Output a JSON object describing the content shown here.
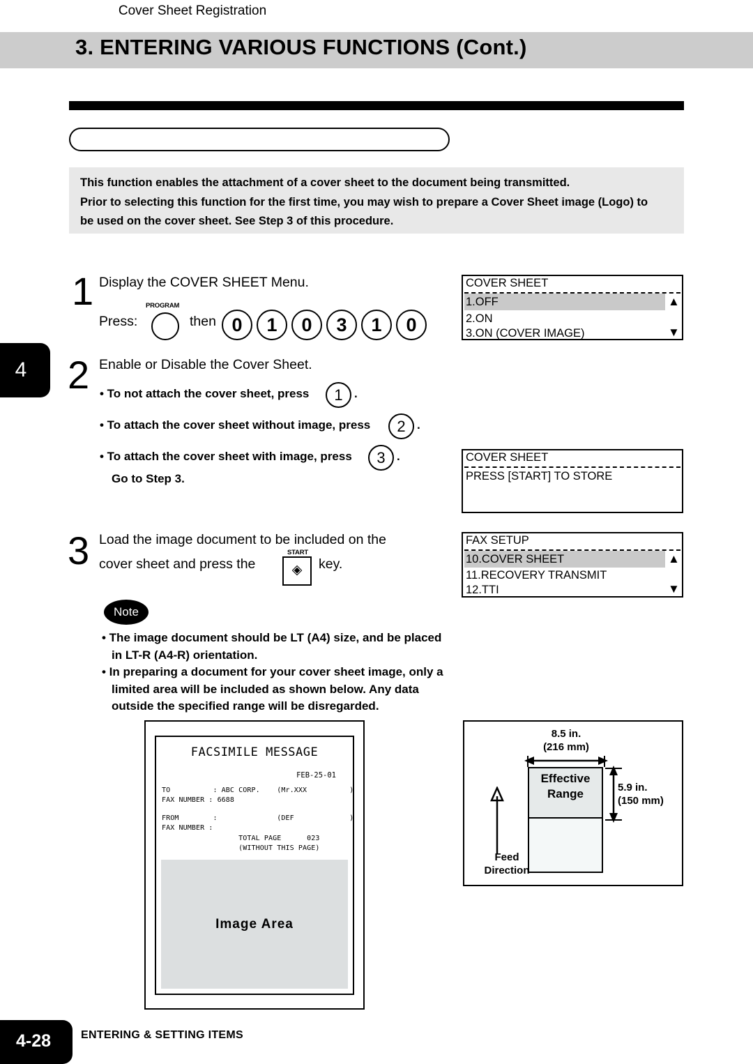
{
  "header": {
    "title": "3. ENTERING VARIOUS FUNCTIONS (Cont.)"
  },
  "section": {
    "pill_label": "Cover Sheet Registration"
  },
  "intro": {
    "line1": "This function enables the attachment of a cover sheet to the document being transmitted.",
    "line2": "Prior to selecting this function for the first time, you may wish to prepare a Cover Sheet image (Logo) to",
    "line3": "be used on the cover sheet.  See Step 3 of this procedure."
  },
  "chapter_tab": {
    "number": "4"
  },
  "steps": {
    "step1": {
      "number": "1",
      "instruction": "Display the COVER SHEET Menu.",
      "press_label": "Press:",
      "program_key_label": "PROGRAM",
      "then_label": "then",
      "keys": [
        "0",
        "1",
        "0",
        "3",
        "1",
        "0"
      ]
    },
    "step2": {
      "number": "2",
      "instruction": "Enable or Disable the Cover Sheet.",
      "bullets": [
        {
          "text": "• To not attach the cover sheet, press",
          "key": "1",
          "suffix": "."
        },
        {
          "text": "• To attach the cover sheet without image, press",
          "key": "2",
          "suffix": "."
        },
        {
          "text": "• To attach the cover sheet with image, press",
          "key": "3",
          "suffix": "."
        }
      ],
      "goto_line": "Go to Step 3."
    },
    "step3": {
      "number": "3",
      "line1": "Load  the  image  document  to be  included  on  the",
      "line2a": "cover sheet and press the",
      "line2b": "key.",
      "start_key_label": "START",
      "start_key_glyph": "◈"
    }
  },
  "lcd_panels": [
    {
      "title": "COVER SHEET",
      "rows": [
        {
          "text": "1.OFF",
          "selected": true,
          "arrow": "▲"
        },
        {
          "text": "2.ON",
          "selected": false,
          "arrow": ""
        },
        {
          "text": "3.ON (COVER IMAGE)",
          "selected": false,
          "arrow": "▼"
        }
      ]
    },
    {
      "title": "COVER SHEET",
      "rows": [
        {
          "text": "PRESS [START] TO STORE",
          "selected": false,
          "arrow": ""
        }
      ]
    },
    {
      "title": "FAX SETUP",
      "rows": [
        {
          "text": "10.COVER SHEET",
          "selected": true,
          "arrow": "▲"
        },
        {
          "text": "11.RECOVERY TRANSMIT",
          "selected": false,
          "arrow": ""
        },
        {
          "text": "12.TTI",
          "selected": false,
          "arrow": "▼"
        }
      ]
    }
  ],
  "note": {
    "badge_label": "Note",
    "lines": [
      "• The image document should be LT (A4) size, and be placed",
      "in LT-R (A4-R) orientation.",
      "• In preparing a document for your cover sheet image, only a",
      "limited  area  will  be  included  as  shown  below.   Any  data",
      "outside the specified range will be disregarded."
    ]
  },
  "sample_fax": {
    "title": "FACSIMILE  MESSAGE",
    "date": "FEB-25-01",
    "rows": [
      "TO          : ABC CORP.    (Mr.XXX          )",
      "FAX NUMBER : 6688",
      "",
      "FROM        :              (DEF             )",
      "FAX NUMBER :",
      "                  TOTAL PAGE      023",
      "                  (WITHOUT THIS PAGE)"
    ],
    "image_area_label": "Image Area"
  },
  "range_diagram": {
    "width_in": "8.5 in.",
    "width_mm": "(216  mm)",
    "height_in": "5.9 in.",
    "height_mm": "(150  mm)",
    "effective_label_line1": "Effective",
    "effective_label_line2": "Range",
    "feed_label_line1": "Feed",
    "feed_label_line2": "Direction"
  },
  "footer": {
    "page_number": "4-28",
    "title": "ENTERING  &  SETTING  ITEMS"
  }
}
